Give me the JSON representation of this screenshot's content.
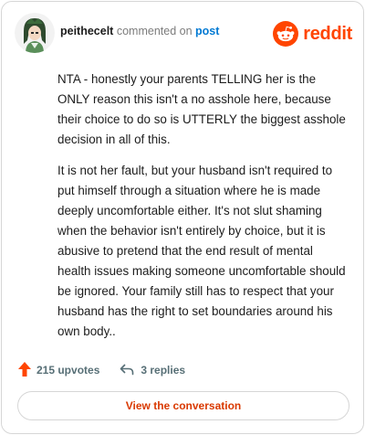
{
  "header": {
    "username": "peithecelt",
    "verb": "commented on",
    "post_link": "post",
    "brand_word": "reddit"
  },
  "comment": {
    "paragraphs": [
      "NTA - honestly your parents TELLING her is the ONLY reason this isn't a no asshole here, because their choice to do so is UTTERLY the biggest asshole decision in all of this.",
      "It is not her fault, but your husband isn't required to put himself through a situation where he is made deeply uncomfortable either. It's not slut shaming when the behavior isn't entirely by choice, but it is abusive to pretend that the end result of mental health issues making someone uncomfortable should be ignored. Your family still has to respect that your husband has the right to set boundaries around his own body.."
    ]
  },
  "actions": {
    "upvotes": "215 upvotes",
    "replies": "3 replies"
  },
  "cta": {
    "label": "View the conversation"
  },
  "colors": {
    "brand": "#ff4500",
    "link": "#0079d3",
    "cta_text": "#d93900",
    "action_text": "#576f76",
    "upvote": "#ff4500"
  },
  "icons": {
    "avatar": "avatar",
    "logo": "reddit-logo-icon",
    "upvote": "upvote-arrow-icon",
    "reply": "reply-arrow-icon"
  }
}
